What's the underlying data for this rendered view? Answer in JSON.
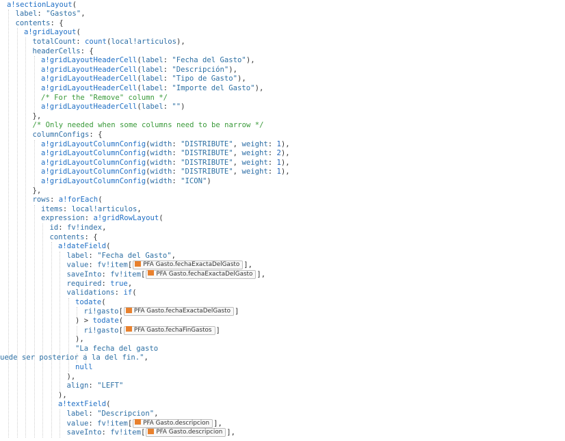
{
  "code_lines": [
    {
      "indent": 0,
      "parts": [
        [
          "fn",
          "a!sectionLayout"
        ],
        [
          "txt",
          "("
        ]
      ]
    },
    {
      "indent": 1,
      "parts": [
        [
          "kw",
          "label"
        ],
        [
          "txt",
          ": "
        ],
        [
          "str",
          "\"Gastos\""
        ],
        [
          "txt",
          ","
        ]
      ]
    },
    {
      "indent": 1,
      "parts": [
        [
          "kw",
          "contents"
        ],
        [
          "txt",
          ": {"
        ]
      ]
    },
    {
      "indent": 2,
      "parts": [
        [
          "fn",
          "a!gridLayout"
        ],
        [
          "txt",
          "("
        ]
      ]
    },
    {
      "indent": 3,
      "parts": [
        [
          "kw",
          "totalCount"
        ],
        [
          "txt",
          ": "
        ],
        [
          "fn",
          "count"
        ],
        [
          "txt",
          "("
        ],
        [
          "kw",
          "local!articulos"
        ],
        [
          "txt",
          "),"
        ]
      ]
    },
    {
      "indent": 3,
      "parts": [
        [
          "kw",
          "headerCells"
        ],
        [
          "txt",
          ": {"
        ]
      ]
    },
    {
      "indent": 4,
      "parts": [
        [
          "fn",
          "a!gridLayoutHeaderCell"
        ],
        [
          "txt",
          "("
        ],
        [
          "kw",
          "label"
        ],
        [
          "txt",
          ": "
        ],
        [
          "str",
          "\"Fecha del Gasto\""
        ],
        [
          "txt",
          "),"
        ]
      ]
    },
    {
      "indent": 4,
      "parts": [
        [
          "fn",
          "a!gridLayoutHeaderCell"
        ],
        [
          "txt",
          "("
        ],
        [
          "kw",
          "label"
        ],
        [
          "txt",
          ": "
        ],
        [
          "str",
          "\"Descripción\""
        ],
        [
          "txt",
          "),"
        ]
      ]
    },
    {
      "indent": 4,
      "parts": [
        [
          "fn",
          "a!gridLayoutHeaderCell"
        ],
        [
          "txt",
          "("
        ],
        [
          "kw",
          "label"
        ],
        [
          "txt",
          ": "
        ],
        [
          "str",
          "\"Tipo de Gasto\""
        ],
        [
          "txt",
          "),"
        ]
      ]
    },
    {
      "indent": 4,
      "parts": [
        [
          "fn",
          "a!gridLayoutHeaderCell"
        ],
        [
          "txt",
          "("
        ],
        [
          "kw",
          "label"
        ],
        [
          "txt",
          ": "
        ],
        [
          "str",
          "\"Importe del Gasto\""
        ],
        [
          "txt",
          "),"
        ]
      ]
    },
    {
      "indent": 4,
      "parts": [
        [
          "cmt",
          "/* For the \"Remove\" column */"
        ]
      ]
    },
    {
      "indent": 4,
      "parts": [
        [
          "fn",
          "a!gridLayoutHeaderCell"
        ],
        [
          "txt",
          "("
        ],
        [
          "kw",
          "label"
        ],
        [
          "txt",
          ": "
        ],
        [
          "str",
          "\"\""
        ],
        [
          "txt",
          ")"
        ]
      ]
    },
    {
      "indent": 3,
      "parts": [
        [
          "txt",
          "},"
        ]
      ]
    },
    {
      "indent": 3,
      "parts": [
        [
          "cmt",
          "/* Only needed when some columns need to be narrow */"
        ]
      ]
    },
    {
      "indent": 3,
      "parts": [
        [
          "kw",
          "columnConfigs"
        ],
        [
          "txt",
          ": {"
        ]
      ]
    },
    {
      "indent": 4,
      "parts": [
        [
          "fn",
          "a!gridLayoutColumnConfig"
        ],
        [
          "txt",
          "("
        ],
        [
          "kw",
          "width"
        ],
        [
          "txt",
          ": "
        ],
        [
          "str",
          "\"DISTRIBUTE\""
        ],
        [
          "txt",
          ", "
        ],
        [
          "kw",
          "weight"
        ],
        [
          "txt",
          ": "
        ],
        [
          "num",
          "1"
        ],
        [
          "txt",
          "),"
        ]
      ]
    },
    {
      "indent": 4,
      "parts": [
        [
          "fn",
          "a!gridLayoutColumnConfig"
        ],
        [
          "txt",
          "("
        ],
        [
          "kw",
          "width"
        ],
        [
          "txt",
          ": "
        ],
        [
          "str",
          "\"DISTRIBUTE\""
        ],
        [
          "txt",
          ", "
        ],
        [
          "kw",
          "weight"
        ],
        [
          "txt",
          ": "
        ],
        [
          "num",
          "2"
        ],
        [
          "txt",
          "),"
        ]
      ]
    },
    {
      "indent": 4,
      "parts": [
        [
          "fn",
          "a!gridLayoutColumnConfig"
        ],
        [
          "txt",
          "("
        ],
        [
          "kw",
          "width"
        ],
        [
          "txt",
          ": "
        ],
        [
          "str",
          "\"DISTRIBUTE\""
        ],
        [
          "txt",
          ", "
        ],
        [
          "kw",
          "weight"
        ],
        [
          "txt",
          ": "
        ],
        [
          "num",
          "1"
        ],
        [
          "txt",
          "),"
        ]
      ]
    },
    {
      "indent": 4,
      "parts": [
        [
          "fn",
          "a!gridLayoutColumnConfig"
        ],
        [
          "txt",
          "("
        ],
        [
          "kw",
          "width"
        ],
        [
          "txt",
          ": "
        ],
        [
          "str",
          "\"DISTRIBUTE\""
        ],
        [
          "txt",
          ", "
        ],
        [
          "kw",
          "weight"
        ],
        [
          "txt",
          ": "
        ],
        [
          "num",
          "1"
        ],
        [
          "txt",
          "),"
        ]
      ]
    },
    {
      "indent": 4,
      "parts": [
        [
          "fn",
          "a!gridLayoutColumnConfig"
        ],
        [
          "txt",
          "("
        ],
        [
          "kw",
          "width"
        ],
        [
          "txt",
          ": "
        ],
        [
          "str",
          "\"ICON\""
        ],
        [
          "txt",
          ")"
        ]
      ]
    },
    {
      "indent": 3,
      "parts": [
        [
          "txt",
          "},"
        ]
      ]
    },
    {
      "indent": 3,
      "parts": [
        [
          "kw",
          "rows"
        ],
        [
          "txt",
          ": "
        ],
        [
          "fn",
          "a!forEach"
        ],
        [
          "txt",
          "("
        ]
      ]
    },
    {
      "indent": 4,
      "parts": [
        [
          "kw",
          "items"
        ],
        [
          "txt",
          ": "
        ],
        [
          "kw",
          "local!articulos"
        ],
        [
          "txt",
          ","
        ]
      ]
    },
    {
      "indent": 4,
      "parts": [
        [
          "kw",
          "expression"
        ],
        [
          "txt",
          ": "
        ],
        [
          "fn",
          "a!gridRowLayout"
        ],
        [
          "txt",
          "("
        ]
      ]
    },
    {
      "indent": 5,
      "parts": [
        [
          "kw",
          "id"
        ],
        [
          "txt",
          ": "
        ],
        [
          "kw",
          "fv!index"
        ],
        [
          "txt",
          ","
        ]
      ]
    },
    {
      "indent": 5,
      "parts": [
        [
          "kw",
          "contents"
        ],
        [
          "txt",
          ": {"
        ]
      ]
    },
    {
      "indent": 6,
      "parts": [
        [
          "fn",
          "a!dateField"
        ],
        [
          "txt",
          "("
        ]
      ]
    },
    {
      "indent": 7,
      "parts": [
        [
          "kw",
          "label"
        ],
        [
          "txt",
          ": "
        ],
        [
          "str",
          "\"Fecha del Gasto\""
        ],
        [
          "txt",
          ","
        ]
      ]
    },
    {
      "indent": 7,
      "parts": [
        [
          "kw",
          "value"
        ],
        [
          "txt",
          ": "
        ],
        [
          "kw",
          "fv!item"
        ],
        [
          "txt",
          "["
        ],
        [
          "tok",
          "PFA Gasto.fechaExactaDelGasto"
        ],
        [
          "txt",
          "],"
        ]
      ]
    },
    {
      "indent": 7,
      "parts": [
        [
          "kw",
          "saveInto"
        ],
        [
          "txt",
          ": "
        ],
        [
          "kw",
          "fv!item"
        ],
        [
          "txt",
          "["
        ],
        [
          "tok",
          "PFA Gasto.fechaExactaDelGasto"
        ],
        [
          "txt",
          "],"
        ]
      ]
    },
    {
      "indent": 7,
      "parts": [
        [
          "kw",
          "required"
        ],
        [
          "txt",
          ": "
        ],
        [
          "fn",
          "true"
        ],
        [
          "txt",
          ","
        ]
      ]
    },
    {
      "indent": 7,
      "parts": [
        [
          "kw",
          "validations"
        ],
        [
          "txt",
          ": "
        ],
        [
          "fn",
          "if"
        ],
        [
          "txt",
          "("
        ]
      ]
    },
    {
      "indent": 8,
      "parts": [
        [
          "fn",
          "todate"
        ],
        [
          "txt",
          "("
        ]
      ]
    },
    {
      "indent": 9,
      "parts": [
        [
          "kw",
          "ri!gasto"
        ],
        [
          "txt",
          "["
        ],
        [
          "tok",
          "PFA Gasto.fechaExactaDelGasto"
        ],
        [
          "txt",
          "]"
        ]
      ]
    },
    {
      "indent": 8,
      "parts": [
        [
          "txt",
          ") > "
        ],
        [
          "fn",
          "todate"
        ],
        [
          "txt",
          "("
        ]
      ]
    },
    {
      "indent": 9,
      "parts": [
        [
          "kw",
          "ri!gasto"
        ],
        [
          "txt",
          "["
        ],
        [
          "tok",
          "PFA Gasto.fechaFinGastos"
        ],
        [
          "txt",
          "]"
        ]
      ]
    },
    {
      "indent": 8,
      "parts": [
        [
          "txt",
          "),"
        ]
      ]
    },
    {
      "indent": 8,
      "parts": [
        [
          "str",
          "\"La fecha del gasto"
        ]
      ]
    },
    {
      "indent": -1,
      "parts": [
        [
          "str",
          "uede ser posterior a la del fin.\""
        ],
        [
          "txt",
          ","
        ]
      ]
    },
    {
      "indent": 8,
      "parts": [
        [
          "fn",
          "null"
        ]
      ]
    },
    {
      "indent": 7,
      "parts": [
        [
          "txt",
          "),"
        ]
      ]
    },
    {
      "indent": 7,
      "parts": [
        [
          "kw",
          "align"
        ],
        [
          "txt",
          ": "
        ],
        [
          "str",
          "\"LEFT\""
        ]
      ]
    },
    {
      "indent": 6,
      "parts": [
        [
          "txt",
          "),"
        ]
      ]
    },
    {
      "indent": 6,
      "parts": [
        [
          "fn",
          "a!textField"
        ],
        [
          "txt",
          "("
        ]
      ]
    },
    {
      "indent": 7,
      "parts": [
        [
          "kw",
          "label"
        ],
        [
          "txt",
          ": "
        ],
        [
          "str",
          "\"Descripcion\""
        ],
        [
          "txt",
          ","
        ]
      ]
    },
    {
      "indent": 7,
      "parts": [
        [
          "kw",
          "value"
        ],
        [
          "txt",
          ": "
        ],
        [
          "kw",
          "fv!item"
        ],
        [
          "txt",
          "["
        ],
        [
          "tok",
          "PFA Gasto.descripcion"
        ],
        [
          "txt",
          "],"
        ]
      ]
    },
    {
      "indent": 7,
      "parts": [
        [
          "kw",
          "saveInto"
        ],
        [
          "txt",
          ": "
        ],
        [
          "kw",
          "fv!item"
        ],
        [
          "txt",
          "["
        ],
        [
          "tok",
          "PFA Gasto.descripcion"
        ],
        [
          "txt",
          "],"
        ]
      ]
    }
  ]
}
